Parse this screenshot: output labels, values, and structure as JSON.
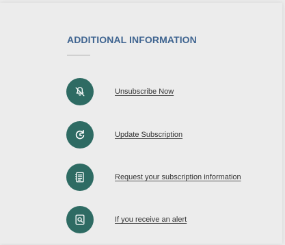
{
  "section": {
    "title": "ADDITIONAL INFORMATION"
  },
  "links": [
    {
      "label": "Unsubscribe Now",
      "icon": "bell-off-icon"
    },
    {
      "label": "Update Subscription",
      "icon": "refresh-icon"
    },
    {
      "label": "Request your subscription information",
      "icon": "notebook-icon"
    },
    {
      "label": "If you receive an alert",
      "icon": "search-document-icon"
    }
  ],
  "colors": {
    "heading": "#3f6490",
    "icon_circle": "#2e6b63",
    "background": "#ececec"
  }
}
